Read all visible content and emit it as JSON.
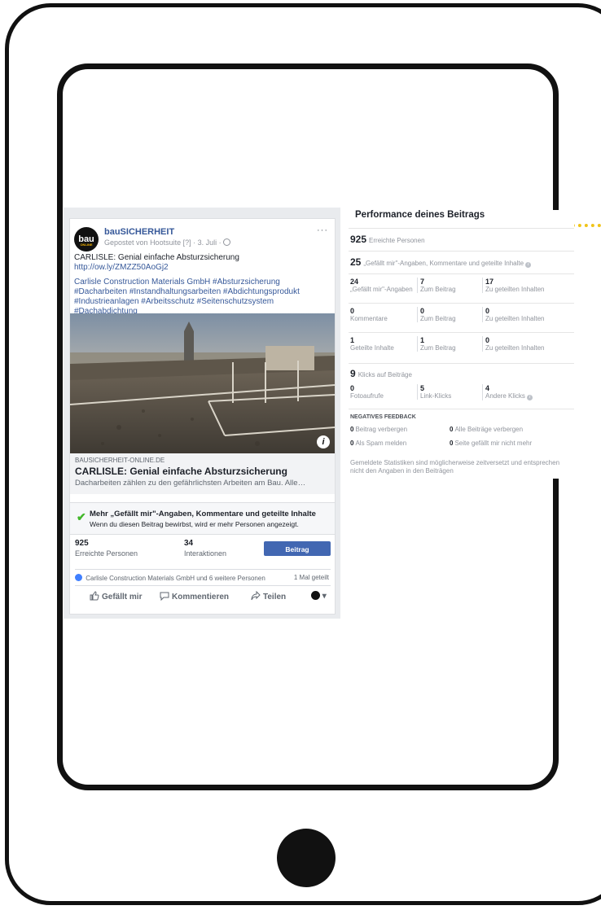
{
  "post": {
    "page_name": "bauSICHERHEIT",
    "avatar_text": "bau",
    "avatar_subtext": "ONLINE",
    "posted_via": "Gepostet von",
    "posted_app": "Hootsuite",
    "meta_rest": "[?] · 3. Juli ·",
    "more": "···",
    "line1": "CARLISLE: Genial einfache Absturzsicherung",
    "link_url": "http://ow.ly/ZMZZ50AoGj2",
    "hashtags": "Carlisle Construction Materials GmbH #Absturzsicherung #Dacharbeiten #Instandhaltungsarbeiten #Abdichtungsprodukt #Industrieanlagen #Arbeitsschutz #Seitenschutzsystem #Dachabdichtung",
    "info_glyph": "i",
    "link_domain": "BAUSICHERHEIT-ONLINE.DE",
    "link_title": "CARLISLE: Genial einfache Absturzsicherung",
    "link_desc": "Dacharbeiten zählen zu den gefährlichsten Arbeiten am Bau. Alle…",
    "promo_title": "Mehr „Gefällt mir\"-Angaben, Kommentare und geteilte Inhalte",
    "promo_sub": "Wenn du diesen Beitrag bewirbst, wird er mehr Personen angezeigt.",
    "reach_value": "925",
    "reach_label": "Erreichte Personen",
    "interactions_value": "34",
    "interactions_label": "Interaktionen",
    "boost_label": "Beitrag bewerben",
    "shares_people": "Carlisle Construction Materials GmbH und 6 weitere Personen",
    "shares_count": "1 Mal geteilt",
    "action_like": "Gefällt mir",
    "action_comment": "Kommentieren",
    "action_share": "Teilen"
  },
  "performance": {
    "title": "Performance deines Beitrags",
    "reach_num": "925",
    "reach_label": "Erreichte Personen",
    "engage_num": "25",
    "engage_label": "„Gefällt mir\"-Angaben, Kommentare und geteilte Inhalte",
    "grid": [
      [
        {
          "v": "24",
          "l": "„Gefällt mir\"-Angaben"
        },
        {
          "v": "7",
          "l": "Zum Beitrag"
        },
        {
          "v": "17",
          "l": "Zu geteilten Inhalten"
        }
      ],
      [
        {
          "v": "0",
          "l": "Kommentare"
        },
        {
          "v": "0",
          "l": "Zum Beitrag"
        },
        {
          "v": "0",
          "l": "Zu geteilten Inhalten"
        }
      ],
      [
        {
          "v": "1",
          "l": "Geteilte Inhalte"
        },
        {
          "v": "1",
          "l": "Zum Beitrag"
        },
        {
          "v": "0",
          "l": "Zu geteilten Inhalten"
        }
      ]
    ],
    "clicks_num": "9",
    "clicks_label": "Klicks auf Beiträge",
    "clicks": [
      {
        "v": "0",
        "l": "Fotoaufrufe"
      },
      {
        "v": "5",
        "l": "Link-Klicks"
      },
      {
        "v": "4",
        "l": "Andere Klicks"
      }
    ],
    "neg_title": "NEGATIVES FEEDBACK",
    "neg": [
      {
        "v": "0",
        "l": "Beitrag verbergen"
      },
      {
        "v": "0",
        "l": "Alle Beiträge verbergen"
      },
      {
        "v": "0",
        "l": "Als Spam melden"
      },
      {
        "v": "0",
        "l": "Seite gefällt mir nicht mehr"
      }
    ],
    "footnote": "Gemeldete Statistiken sind möglicherweise zeitversetzt und entsprechen nicht den Angaben in den Beiträgen"
  },
  "colors": {
    "fb_blue": "#4267b2",
    "link_blue": "#365899",
    "accent_dots": "#f0c419",
    "check_green": "#42b72a"
  }
}
